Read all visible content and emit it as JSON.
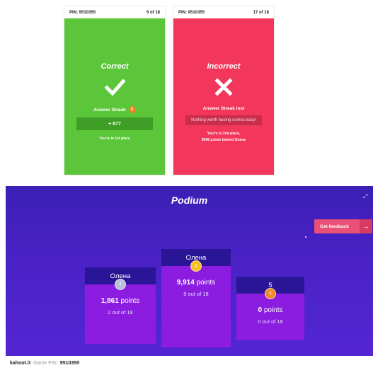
{
  "phone_correct": {
    "pin": "PIN: 9510355",
    "progress": "5 of 18",
    "title": "Correct",
    "icon": "checkmark-icon",
    "streak_label": "Answer Streak",
    "streak_count": "3",
    "points": "+ 677",
    "place": "You're in 1st place",
    "color": "#5cc63a"
  },
  "phone_incorrect": {
    "pin": "PIN: 9510355",
    "progress": "17 of 18",
    "title": "Incorrect",
    "icon": "cross-icon",
    "streak_label": "Answer Streak lost",
    "message": "Nothing worth having comes easy!",
    "place": "You're in 2nd place,",
    "behind": "8996 points behind Олена",
    "color": "#f2365c"
  },
  "podium": {
    "title": "Podium",
    "feedback_button": "Get feedback",
    "feedback_arrow": "→",
    "players": [
      {
        "rank": "2",
        "name": "Олена",
        "points_value": "1,861",
        "points_unit": " points",
        "answers": "2 out of 18",
        "medal": "medal-silver"
      },
      {
        "rank": "1",
        "name": "Олена",
        "points_value": "9,914",
        "points_unit": " points",
        "answers": "9 out of 18",
        "medal": "medal-gold"
      },
      {
        "rank": "3",
        "name": "5",
        "points_value": "0",
        "points_unit": " points",
        "answers": "0 out of 18",
        "medal": "medal-bronze"
      }
    ],
    "background": "#4a22c6",
    "block_color": "#8b1ce0"
  },
  "footer": {
    "brand": "kahoot.it",
    "pin_label": "Game PIN:",
    "pin": "9510355"
  }
}
